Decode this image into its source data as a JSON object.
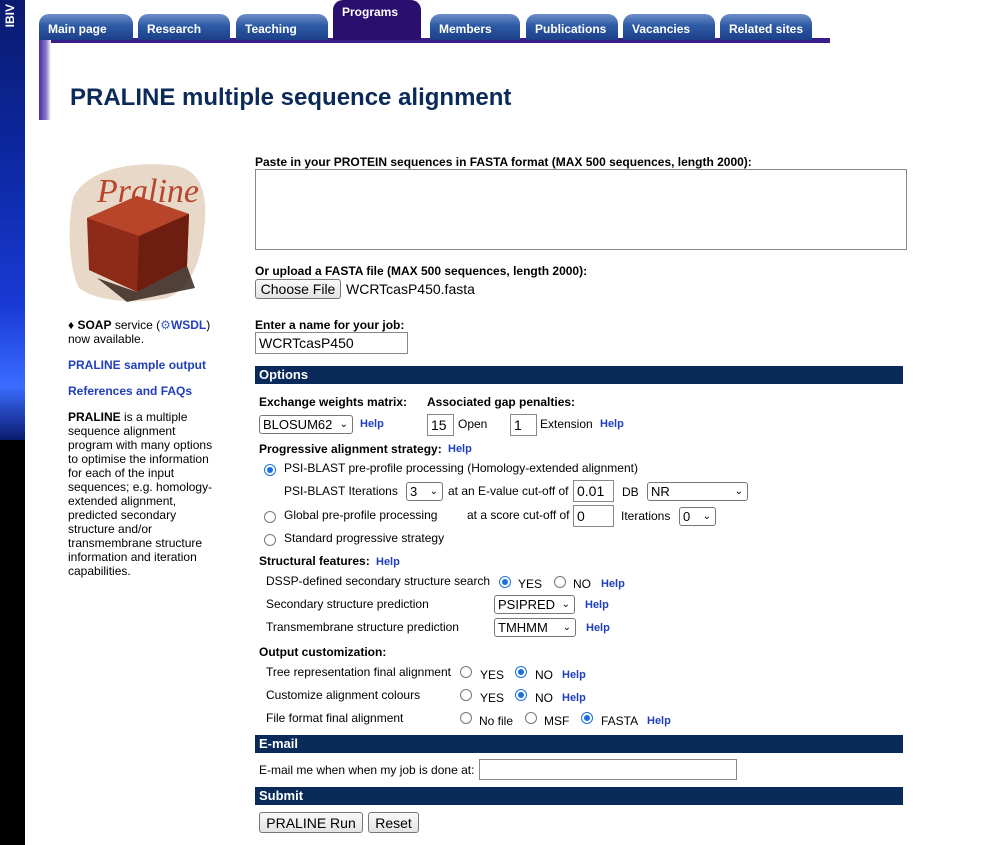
{
  "brand_text": "IBIV",
  "tabs": [
    {
      "label": "Main page",
      "active": false
    },
    {
      "label": "Research",
      "active": false
    },
    {
      "label": "Teaching",
      "active": false
    },
    {
      "label": "Programs",
      "active": true
    },
    {
      "label": "Members",
      "active": false
    },
    {
      "label": "Publications",
      "active": false
    },
    {
      "label": "Vacancies",
      "active": false
    },
    {
      "label": "Related sites",
      "active": false
    }
  ],
  "page_title": "PRALINE multiple sequence alignment",
  "logo_text": "Praline",
  "sidebar": {
    "soap_prefix": "♦ ",
    "soap_bold": "SOAP",
    "soap_mid": " service (",
    "wsdl": "WSDL",
    "soap_end": ")",
    "soap_line2": "now available.",
    "sample_output": "PRALINE sample output",
    "refs": "References and FAQs",
    "desc_bold": "PRALINE",
    "desc": " is a multiple sequence alignment program with many options to optimise the information for each of the input sequences; e.g. homology-extended alignment, predicted secondary structure and/or transmembrane structure information and iteration capabilities."
  },
  "form": {
    "paste_label": "Paste in your PROTEIN sequences in FASTA format (MAX 500 sequences, length 2000):",
    "upload_label": "Or upload a FASTA file (MAX 500 sequences, length 2000):",
    "choose_file": "Choose File",
    "file_name": "WCRTcasP450.fasta",
    "jobname_label": "Enter a name for your job:",
    "jobname_value": "WCRTcasP450"
  },
  "options": {
    "header": "Options",
    "matrix_label": "Exchange weights matrix:",
    "matrix_value": "BLOSUM62",
    "gap_label": "Associated gap penalties:",
    "gap_open": "15",
    "open_text": "Open",
    "gap_ext": "1",
    "ext_text": "Extension",
    "help": "Help",
    "strategy_label": "Progressive alignment strategy:",
    "psi_label": "PSI-BLAST pre-profile processing (Homology-extended alignment)",
    "psi_iter_label": "PSI-BLAST Iterations",
    "psi_iter_value": "3",
    "evalue_label": "at an E-value cut-off of",
    "evalue_value": "0.01",
    "db_label": "DB",
    "db_value": "NR",
    "global_label": "Global pre-profile processing",
    "score_label": "at a score cut-off of",
    "score_value": "0",
    "iterations_label": "Iterations",
    "iterations_value": "0",
    "standard_label": "Standard progressive strategy",
    "struct_label": "Structural features:",
    "dssp_label": "DSSP-defined secondary structure search",
    "yes": "YES",
    "no": "NO",
    "ss_pred_label": "Secondary structure prediction",
    "ss_pred_value": "PSIPRED",
    "tm_pred_label": "Transmembrane structure prediction",
    "tm_pred_value": "TMHMM",
    "output_label": "Output customization:",
    "tree_label": "Tree representation final alignment",
    "colours_label": "Customize alignment colours",
    "format_label": "File format final alignment",
    "no_file": "No file",
    "msf": "MSF",
    "fasta": "FASTA"
  },
  "email": {
    "header": "E-mail",
    "label": "E-mail me when when my job is done at:",
    "value": ""
  },
  "submit": {
    "header": "Submit",
    "run": "PRALINE Run",
    "reset": "Reset"
  }
}
